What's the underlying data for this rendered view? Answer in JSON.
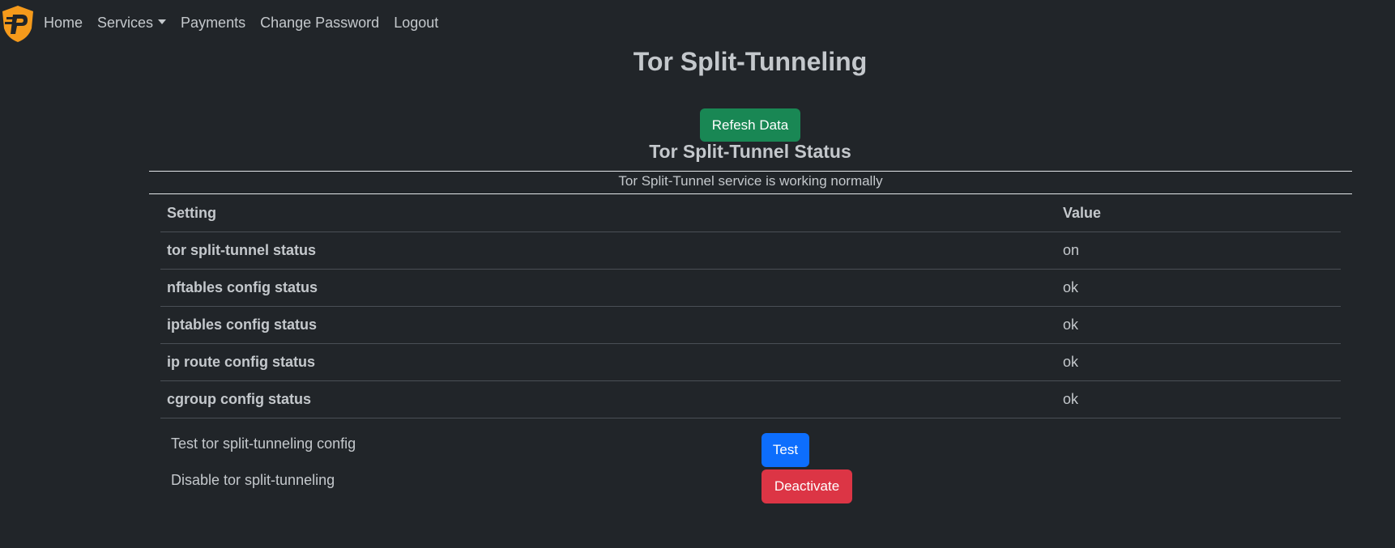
{
  "nav": {
    "items": [
      {
        "label": "Home"
      },
      {
        "label": "Services"
      },
      {
        "label": "Payments"
      },
      {
        "label": "Change Password"
      },
      {
        "label": "Logout"
      }
    ]
  },
  "page": {
    "title": "Tor Split-Tunneling",
    "refresh_label": "Refesh Data",
    "status_heading": "Tor Split-Tunnel Status",
    "status_message": "Tor Split-Tunnel service is working normally"
  },
  "table": {
    "headers": {
      "setting": "Setting",
      "value": "Value"
    },
    "rows": [
      {
        "setting": "tor split-tunnel status",
        "value": "on"
      },
      {
        "setting": "nftables config status",
        "value": "ok"
      },
      {
        "setting": "iptables config status",
        "value": "ok"
      },
      {
        "setting": "ip route config status",
        "value": "ok"
      },
      {
        "setting": "cgroup config status",
        "value": "ok"
      }
    ]
  },
  "actions": {
    "test_label": "Test tor split-tunneling config",
    "test_button": "Test",
    "disable_label": "Disable tor split-tunneling",
    "deactivate_button": "Deactivate"
  },
  "colors": {
    "background": "#212529",
    "logo": "#f59a1b",
    "success": "#198754",
    "primary": "#0d6efd",
    "danger": "#dc3545"
  },
  "icons": {
    "logo": "shield-p-logo-icon",
    "services_dropdown": "caret-down-icon"
  }
}
